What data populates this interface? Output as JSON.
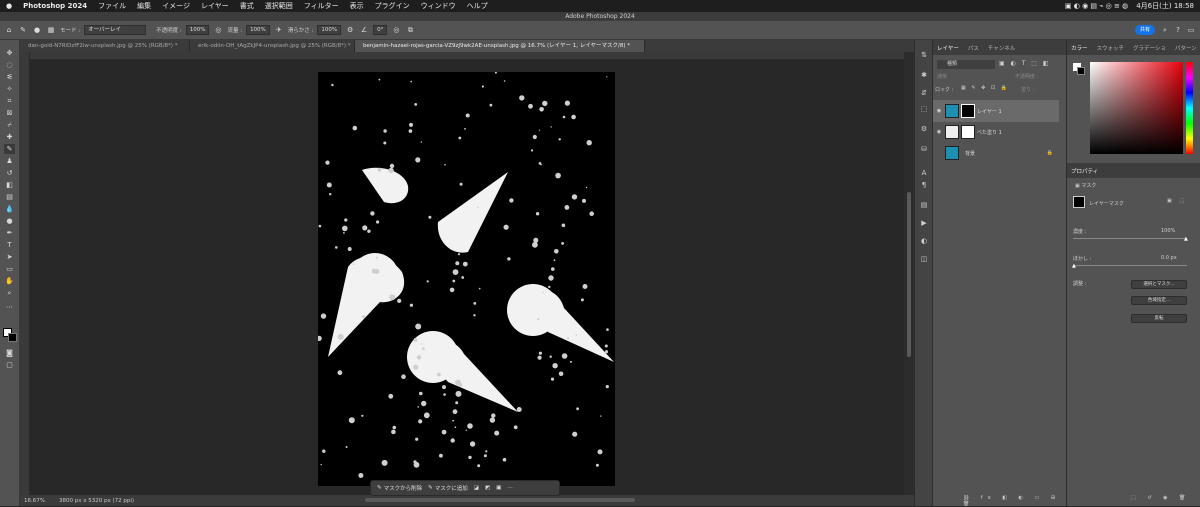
{
  "menubar": {
    "apple": "",
    "items": [
      "Photoshop 2024",
      "ファイル",
      "編集",
      "イメージ",
      "レイヤー",
      "書式",
      "選択範囲",
      "フィルター",
      "表示",
      "プラグイン",
      "ウィンドウ",
      "ヘルプ"
    ],
    "clock": "4月6日(土) 18:58"
  },
  "window": {
    "title": "Adobe Photoshop 2024"
  },
  "options": {
    "mode_label": "モード :",
    "mode_value": "オーバーレイ",
    "opacity_label": "不透明度 :",
    "opacity_value": "100%",
    "flow_label": "流量 :",
    "flow_value": "100%",
    "smooth_label": "滑らかさ :",
    "smooth_value": "100%",
    "angle_value": "0°",
    "share_label": "共有"
  },
  "tabs": [
    {
      "label": "dan-gold-N7RiDzfF2iw-unsplash.jpg @ 25% (RGB/8*) *",
      "active": false
    },
    {
      "label": "erik-odiin-OH_tAgZkJP4-unsplash.jpg @ 25% (RGB/8*) *",
      "active": false
    },
    {
      "label": "benjamin-hazael-rojas-garcia-VZ9zJ9wk2AE-unsplash.jpg @ 16.7% (レイヤー 1, レイヤーマスク/8) *",
      "active": true
    }
  ],
  "status": {
    "zoom": "16.67%",
    "docinfo": "3800 px x 5320 px (72 ppi)"
  },
  "context_bar": {
    "btn1": "マスクから削除",
    "btn2": "マスクに追加"
  },
  "layers_panel": {
    "tabs": [
      "レイヤー",
      "パス",
      "チャンネル"
    ],
    "kind": "種類",
    "blend": "通常",
    "opacity_label": "不透明度 :",
    "lock_label": "ロック :",
    "fill_label": "塗り :",
    "layers": [
      {
        "name": "レイヤー 1",
        "selected": true
      },
      {
        "name": "べた塗り 1",
        "selected": false
      },
      {
        "name": "背景",
        "selected": false
      }
    ]
  },
  "color_panel": {
    "tabs": [
      "カラー",
      "スウォッチ",
      "グラデーショ",
      "パターン"
    ]
  },
  "properties": {
    "title": "プロパティ",
    "mask_label": "マスク",
    "layer_mask": "レイヤーマスク",
    "density_label": "濃度 :",
    "density_value": "100%",
    "feather_label": "ぼかし :",
    "feather_value": "0.0 px",
    "adjust_label": "調整 :",
    "btn_select": "選択とマスク...",
    "btn_range": "色域指定...",
    "btn_invert": "反転"
  },
  "colors": {
    "accent": "#1473e6",
    "panel": "#535353"
  }
}
